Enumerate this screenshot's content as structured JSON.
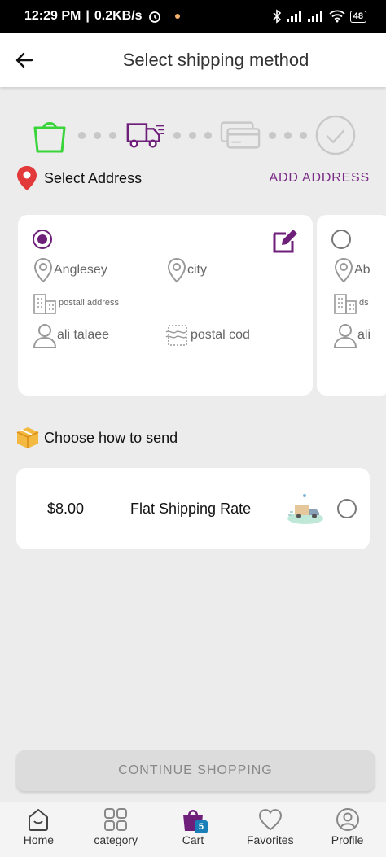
{
  "status_bar": {
    "time": "12:29 PM",
    "speed": "0.2KB/s",
    "battery": "48"
  },
  "header": {
    "title": "Select shipping method"
  },
  "stepper": {
    "steps": [
      "cart",
      "shipping",
      "payment",
      "confirm"
    ],
    "active_index": 1
  },
  "address_section": {
    "title": "Select Address",
    "add_label": "ADD ADDRESS"
  },
  "addresses": [
    {
      "selected": true,
      "city": "Anglesey",
      "city2": "city",
      "postal_address": "postall address",
      "name": "ali talaee",
      "postal_code": "postal cod"
    },
    {
      "selected": false,
      "city": "Ab",
      "postal_address": "ds",
      "name": "ali"
    }
  ],
  "send_section": {
    "title": "Choose how to send"
  },
  "shipping_options": [
    {
      "price": "$8.00",
      "name": "Flat Shipping Rate",
      "selected": false
    }
  ],
  "continue_label": "CONTINUE SHOPPING",
  "bottom_nav": {
    "items": [
      {
        "label": "Home",
        "icon": "home-icon"
      },
      {
        "label": "category",
        "icon": "category-icon"
      },
      {
        "label": "Cart",
        "icon": "cart-icon",
        "badge": "5"
      },
      {
        "label": "Favorites",
        "icon": "heart-icon"
      },
      {
        "label": "Profile",
        "icon": "profile-icon"
      }
    ]
  },
  "colors": {
    "accent": "#6d1f7a",
    "active_step": "#39d439",
    "text_muted": "#666666"
  }
}
